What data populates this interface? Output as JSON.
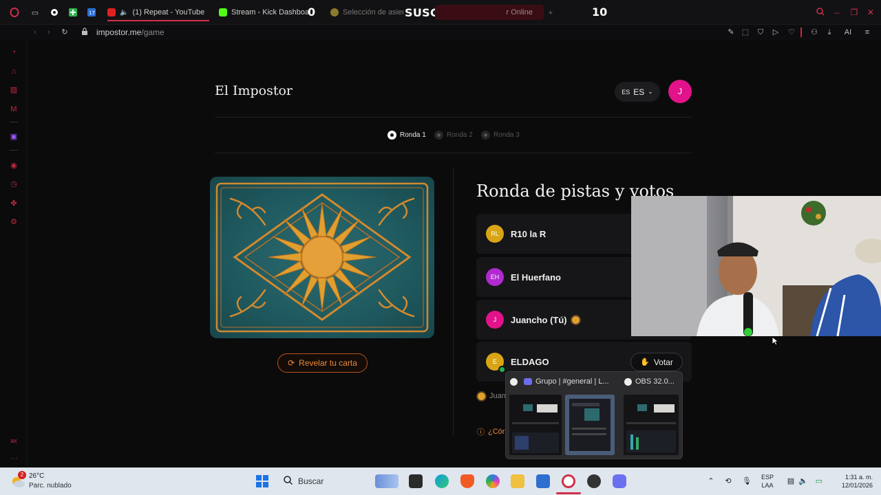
{
  "browser": {
    "tabs": [
      {
        "label": "(1) Repeat - YouTube"
      },
      {
        "label": "Stream - Kick Dashboard"
      },
      {
        "label": "Selección de asient"
      },
      {
        "label": "r Online"
      }
    ],
    "overlay": {
      "left_number": "0",
      "title": "SUSCRIPTORES",
      "right_number": "10"
    },
    "url": {
      "domain": "impostor.me",
      "path": "/game"
    },
    "toolbar_ai_label": "AI"
  },
  "page": {
    "title": "El Impostor",
    "language": {
      "flag_text": "ES",
      "label": "ES"
    },
    "user_initial": "J",
    "rounds": [
      {
        "label": "Ronda 1",
        "active": true
      },
      {
        "label": "Ronda 2",
        "active": false
      },
      {
        "label": "Ronda 3",
        "active": false
      }
    ],
    "reveal_button": "Revelar tu carta",
    "section_title": "Ronda de pistas y votos",
    "players": [
      {
        "initials": "RL",
        "name": "R10 la R",
        "color": "#d9a514"
      },
      {
        "initials": "EH",
        "name": "El Huerfano",
        "color": "#b02ad0"
      },
      {
        "initials": "J",
        "name": "Juancho (Tú)",
        "color": "#e2138a"
      },
      {
        "initials": "E",
        "name": "ELDAGO",
        "color": "#d9a514"
      }
    ],
    "vote_button": "Votar",
    "status_text": "Juan",
    "help_text": "¿Cór"
  },
  "preview": {
    "window1_title": "Grupo | #general | L...",
    "window2_title": "OBS 32.0..."
  },
  "taskbar": {
    "weather_badge": "2",
    "temperature": "26°C",
    "weather_desc": "Parc. nublado",
    "search_placeholder": "Buscar",
    "lang_line1": "ESP",
    "lang_line2": "LAA",
    "time": "1:31 a. m.",
    "date": "12/01/2026"
  },
  "sidebar_bottom_label": "ax"
}
